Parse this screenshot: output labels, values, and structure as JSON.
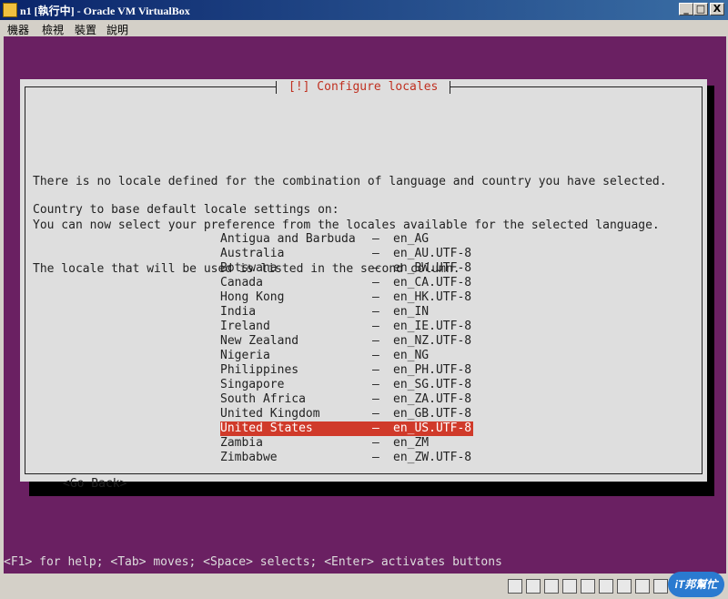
{
  "window": {
    "title": "n1 [執行中] - Oracle VM VirtualBox",
    "minimize_label": "_",
    "maximize_label": "□",
    "close_label": "X"
  },
  "menu": {
    "items": [
      "機器",
      "檢視",
      "裝置",
      "說明"
    ]
  },
  "dialog": {
    "title": "[!] Configure locales",
    "description_lines": [
      "There is no locale defined for the combination of language and country you have selected.",
      "You can now select your preference from the locales available for the selected language.",
      "The locale that will be used is listed in the second column."
    ],
    "prompt": "Country to base default locale settings on:",
    "selected_country": "United States",
    "options": [
      {
        "country": "Antigua and Barbuda",
        "locale": "en_AG"
      },
      {
        "country": "Australia",
        "locale": "en_AU.UTF-8"
      },
      {
        "country": "Botswana",
        "locale": "en_BW.UTF-8"
      },
      {
        "country": "Canada",
        "locale": "en_CA.UTF-8"
      },
      {
        "country": "Hong Kong",
        "locale": "en_HK.UTF-8"
      },
      {
        "country": "India",
        "locale": "en_IN"
      },
      {
        "country": "Ireland",
        "locale": "en_IE.UTF-8"
      },
      {
        "country": "New Zealand",
        "locale": "en_NZ.UTF-8"
      },
      {
        "country": "Nigeria",
        "locale": "en_NG"
      },
      {
        "country": "Philippines",
        "locale": "en_PH.UTF-8"
      },
      {
        "country": "Singapore",
        "locale": "en_SG.UTF-8"
      },
      {
        "country": "South Africa",
        "locale": "en_ZA.UTF-8"
      },
      {
        "country": "United Kingdom",
        "locale": "en_GB.UTF-8"
      },
      {
        "country": "United States",
        "locale": "en_US.UTF-8"
      },
      {
        "country": "Zambia",
        "locale": "en_ZM"
      },
      {
        "country": "Zimbabwe",
        "locale": "en_ZW.UTF-8"
      }
    ],
    "separator": "–",
    "go_back_label": "<Go Back>"
  },
  "help_line": "<F1> for help; <Tab> moves; <Space> selects; <Enter> activates buttons",
  "status_icons": [
    "hard-disk-icon",
    "optical-drive-icon",
    "usb-icon",
    "network-icon",
    "shared-folder-icon",
    "display-icon",
    "video-capture-icon",
    "mouse-integration-icon",
    "host-key-icon"
  ],
  "watermark": "iT邦幫忙",
  "colors": {
    "screen_bg": "#6a2062",
    "dialog_bg": "#dedede",
    "title_text": "#c03020",
    "selection_bg": "#d03a2a"
  }
}
